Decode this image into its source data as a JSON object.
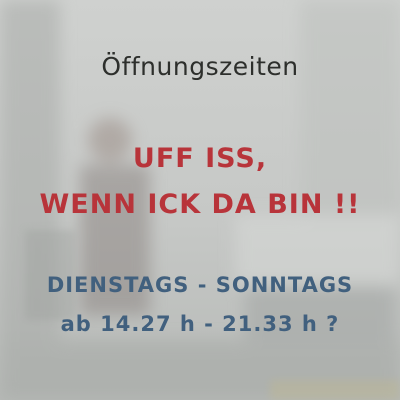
{
  "sign": {
    "title": "Öffnungszeiten",
    "headline_line1": "UFF ISS,",
    "headline_line2": "WENN ICK DA BIN !!",
    "days": "DIENSTAGS - SONNTAGS",
    "hours": "ab 14.27 h - 21.33 h ?"
  },
  "colors": {
    "background": "#c9cbc9",
    "title_text": "#2d2f2c",
    "headline_text": "#b8343a",
    "schedule_text": "#41607e"
  }
}
